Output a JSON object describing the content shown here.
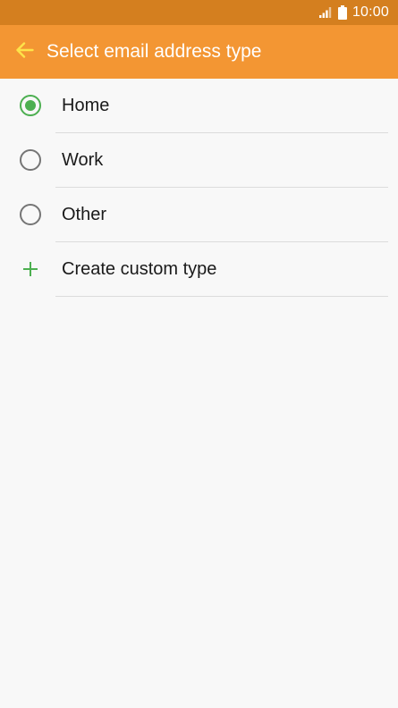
{
  "status_bar": {
    "time": "10:00",
    "signal_icon": "signal-icon",
    "battery_icon": "battery-icon"
  },
  "app_bar": {
    "title": "Select email address type",
    "back_icon": "arrow-back-icon",
    "background_color": "#f39633",
    "back_arrow_color": "#fde44a"
  },
  "options": [
    {
      "label": "Home",
      "selected": true
    },
    {
      "label": "Work",
      "selected": false
    },
    {
      "label": "Other",
      "selected": false
    }
  ],
  "custom_type": {
    "label": "Create custom type",
    "icon": "plus-icon"
  },
  "colors": {
    "status_bar": "#d47f1f",
    "accent_green": "#4caf50"
  }
}
